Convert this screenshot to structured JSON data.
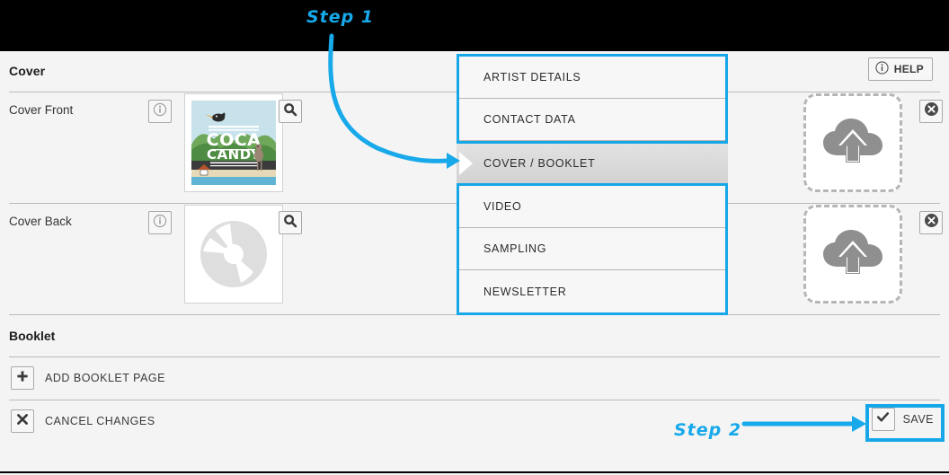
{
  "window": {
    "topbar_color": "#000000",
    "background_color": "#f4f4f4",
    "accent_color": "#16a7e8"
  },
  "cover_section": {
    "title": "Cover",
    "help_label": "HELP",
    "help_icon": "info-circle-icon",
    "rows": [
      {
        "label": "Cover Front",
        "info_icon": "info-circle-icon",
        "zoom_icon": "magnifier-icon",
        "thumbnail": "coca-candy-album-artwork",
        "thumbnail_title_line1": "COCA",
        "thumbnail_title_line2": "CANDY",
        "upload_icon": "cloud-upload-icon",
        "delete_icon": "delete-circle-icon"
      },
      {
        "label": "Cover Back",
        "info_icon": "info-circle-icon",
        "zoom_icon": "magnifier-icon",
        "thumbnail": "cd-disc-placeholder",
        "upload_icon": "cloud-upload-icon",
        "delete_icon": "delete-circle-icon"
      }
    ]
  },
  "booklet_section": {
    "title": "Booklet",
    "add_page_label": "ADD BOOKLET PAGE",
    "add_page_icon": "plus-icon",
    "cancel_label": "CANCEL CHANGES",
    "cancel_icon": "x-icon",
    "save_label": "SAVE",
    "save_icon": "checkmark-icon"
  },
  "nav_menu": {
    "items": [
      {
        "label": "ARTIST DETAILS",
        "active": false
      },
      {
        "label": "CONTACT DATA",
        "active": false
      },
      {
        "label": "COVER / BOOKLET",
        "active": true
      },
      {
        "label": "VIDEO",
        "active": false
      },
      {
        "label": "SAMPLING",
        "active": false
      },
      {
        "label": "NEWSLETTER",
        "active": false
      }
    ]
  },
  "annotations": {
    "step1_label": "Step 1",
    "step2_label": "Step 2",
    "color": "#17a9ea"
  }
}
